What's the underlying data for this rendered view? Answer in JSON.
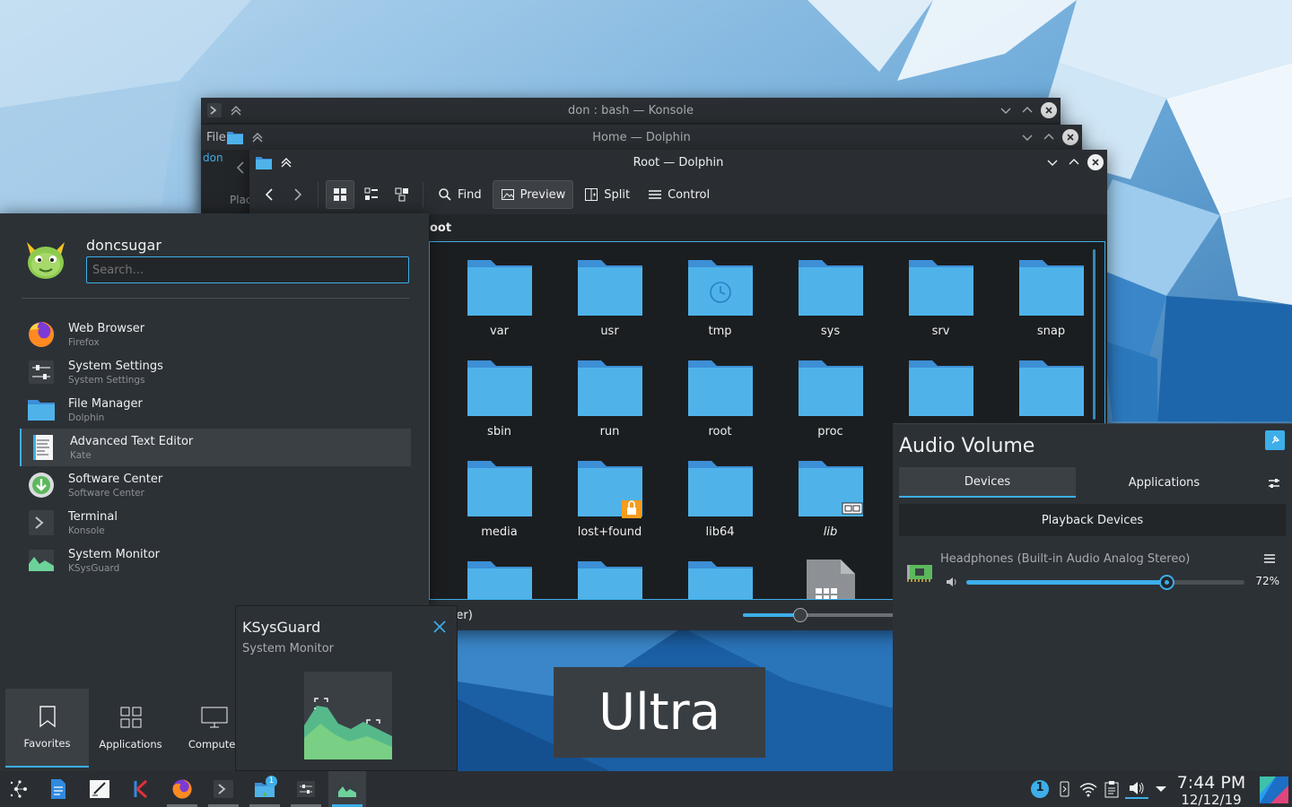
{
  "windows": {
    "konsole": {
      "title": "don : bash — Konsole"
    },
    "dolphin_home": {
      "title": "Home — Dolphin",
      "menu_hint": "File",
      "path_hint": "don",
      "places_hint": "Plac"
    },
    "dolphin_root": {
      "title": "Root — Dolphin",
      "toolbar": {
        "find": "Find",
        "preview": "Preview",
        "split": "Split",
        "control": "Control"
      },
      "breadcrumb": "oot",
      "items": [
        {
          "name": "var"
        },
        {
          "name": "usr"
        },
        {
          "name": "tmp",
          "badge": "clock"
        },
        {
          "name": "sys"
        },
        {
          "name": "srv"
        },
        {
          "name": "snap"
        },
        {
          "name": "sbin"
        },
        {
          "name": "run"
        },
        {
          "name": "root"
        },
        {
          "name": "proc"
        },
        {
          "name": ""
        },
        {
          "name": ""
        },
        {
          "name": "media"
        },
        {
          "name": "lost+found",
          "badge": "lock"
        },
        {
          "name": "lib64"
        },
        {
          "name": "lib",
          "badge": "link",
          "italic": true
        },
        {
          "name": ""
        },
        {
          "name": ""
        },
        {
          "name": ""
        },
        {
          "name": ""
        },
        {
          "name": ""
        },
        {
          "name": "",
          "type": "file"
        },
        {
          "name": ""
        },
        {
          "name": ""
        }
      ],
      "status_text": "folder)"
    }
  },
  "launcher": {
    "username": "doncsugar",
    "search_placeholder": "Search...",
    "favorites": [
      {
        "name": "Web Browser",
        "app": "Firefox",
        "icon": "firefox-icon"
      },
      {
        "name": "System Settings",
        "app": "System Settings",
        "icon": "settings-icon"
      },
      {
        "name": "File Manager",
        "app": "Dolphin",
        "icon": "folder-icon"
      },
      {
        "name": "Advanced Text Editor",
        "app": "Kate",
        "icon": "kate-icon",
        "highlighted": true
      },
      {
        "name": "Software Center",
        "app": "Software Center",
        "icon": "download-icon"
      },
      {
        "name": "Terminal",
        "app": "Konsole",
        "icon": "terminal-icon"
      },
      {
        "name": "System Monitor",
        "app": "KSysGuard",
        "icon": "monitor-icon"
      }
    ],
    "tabs": [
      {
        "label": "Favorites",
        "selected": true
      },
      {
        "label": "Applications"
      },
      {
        "label": "Computer"
      }
    ]
  },
  "tooltip": {
    "title": "KSysGuard",
    "subtitle": "System Monitor"
  },
  "ultra_text": "Ultra",
  "audio": {
    "title": "Audio Volume",
    "tabs": [
      {
        "label": "Devices",
        "selected": true
      },
      {
        "label": "Applications"
      }
    ],
    "section": "Playback Devices",
    "device_name": "Headphones (Built-in Audio Analog Stereo)",
    "volume_percent": 72,
    "volume_label": "72%"
  },
  "taskbar": {
    "time": "7:44 PM",
    "date": "12/12/19",
    "notification_count": "1",
    "dolphin_badge": "1"
  },
  "colors": {
    "accent": "#3daee9",
    "window": "#232629",
    "titlebar": "#2a2e32",
    "panel": "#2c3136",
    "folder": "#4fb3ea"
  }
}
